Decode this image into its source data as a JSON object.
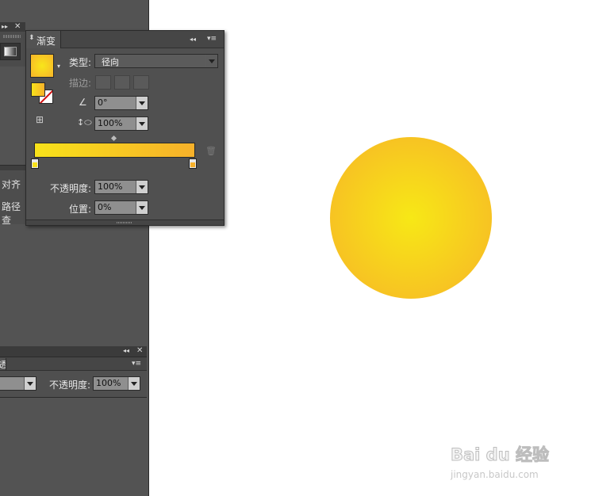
{
  "gradient_panel": {
    "title": "渐变",
    "type_label": "类型:",
    "type_value": "径向",
    "stroke_label": "描边:",
    "angle_value": "0°",
    "aspect_value": "100%",
    "opacity_label": "不透明度:",
    "opacity_value": "100%",
    "location_label": "位置:",
    "location_value": "0%",
    "start_color": "#f8e21a",
    "end_color": "#f7b12a"
  },
  "left_panels": {
    "align_label": "对齐",
    "pathfinder_label": "路径查"
  },
  "bottom_panel": {
    "tab_label": "透",
    "opacity_label": "不透明度:",
    "opacity_value": "100%"
  },
  "artwork": {
    "center_color": "#f7e816",
    "edge_color": "#f7b428"
  },
  "watermark": {
    "brand": "Bai du 经验",
    "url": "jingyan.baidu.com"
  }
}
